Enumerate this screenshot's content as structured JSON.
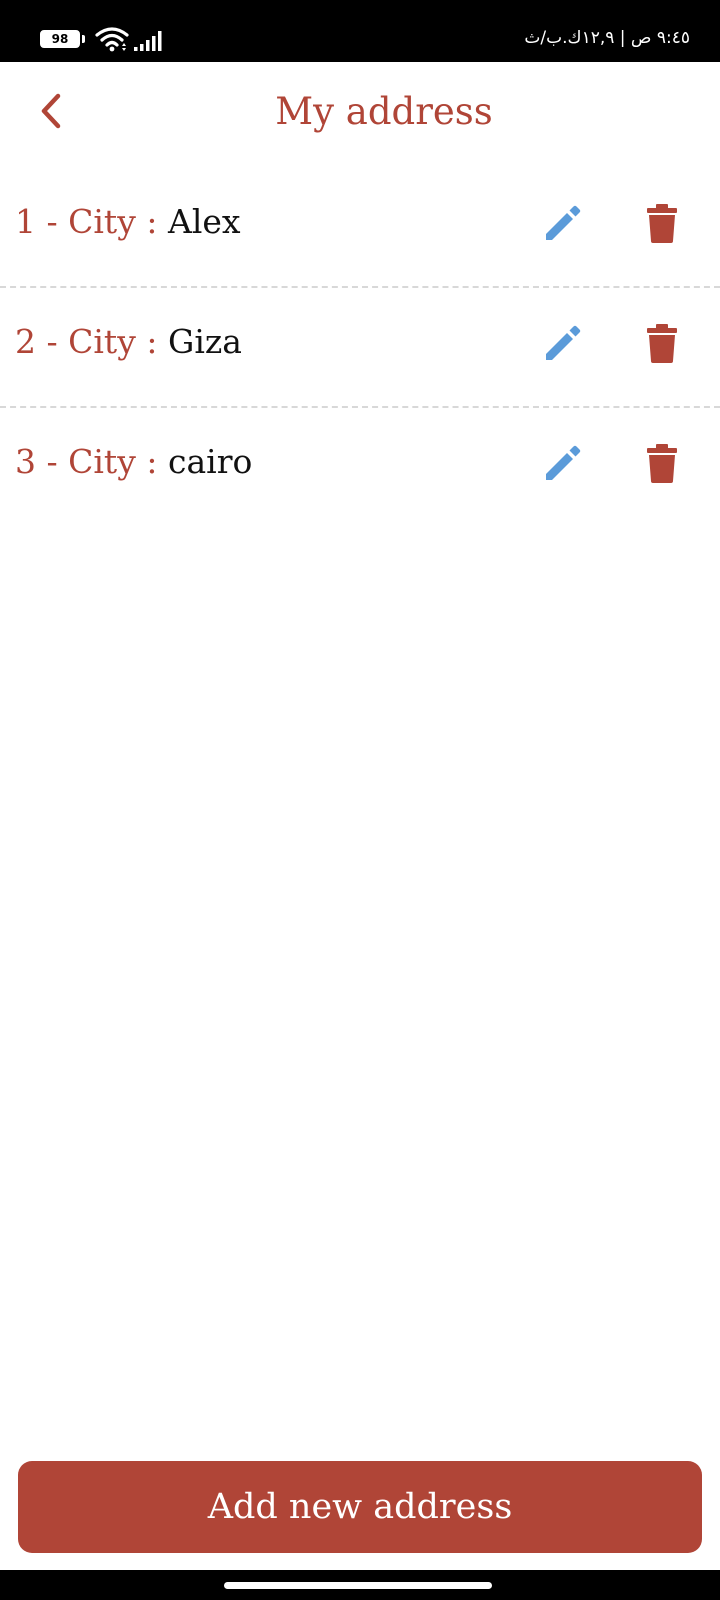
{
  "status_bar": {
    "battery_level": "98",
    "time_text": "٩:٤٥ ص | ١٢,٩ك.ب/ث",
    "icons": [
      "battery-icon",
      "wifi-icon",
      "signal-icon"
    ]
  },
  "header": {
    "title": "My address",
    "back_icon": "chevron-left-icon"
  },
  "addresses": [
    {
      "label": "1 - City :",
      "city": "Alex"
    },
    {
      "label": "2 - City :",
      "city": "Giza"
    },
    {
      "label": "3 - City :",
      "city": "cairo"
    }
  ],
  "row_icons": {
    "edit": "pencil-icon",
    "delete": "trash-icon"
  },
  "footer": {
    "add_button_label": "Add new address"
  },
  "colors": {
    "accent": "#b04537",
    "edit_icon": "#5b9bd9",
    "text": "#111111",
    "divider": "#d8d8d8",
    "background": "#ffffff"
  }
}
